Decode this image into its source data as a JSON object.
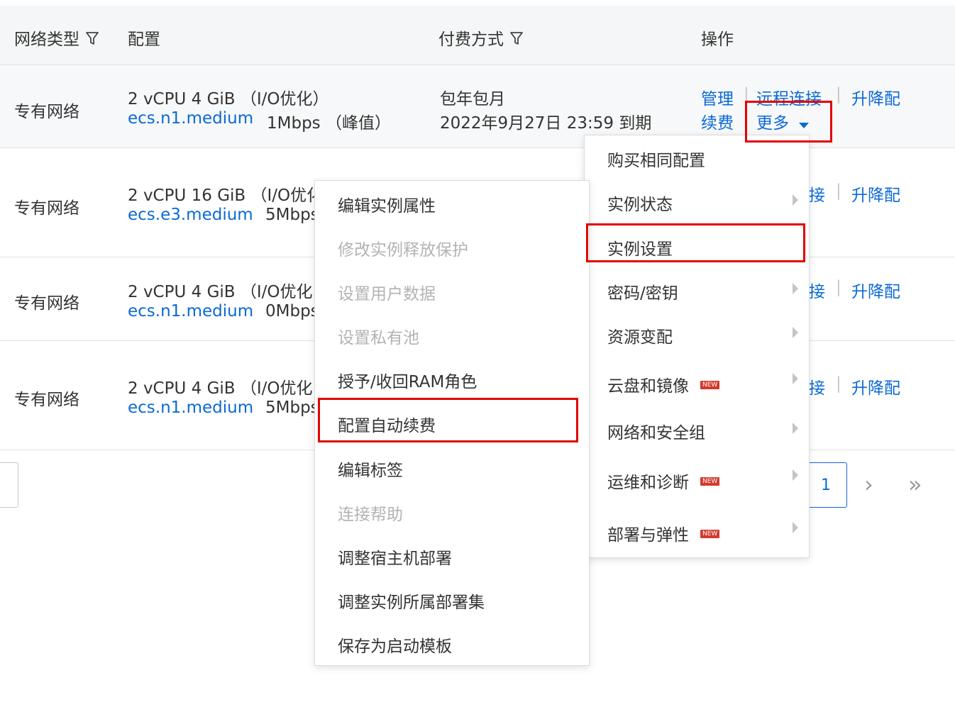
{
  "table": {
    "columns": {
      "network_type": "网络类型",
      "config": "配置",
      "payment": "付费方式",
      "actions": "操作"
    },
    "rows": [
      {
        "network": "专有网络",
        "spec": "2 vCPU 4 GiB （I/O优化）",
        "instance_type": "ecs.n1.medium",
        "bandwidth": "1Mbps （峰值）",
        "payment_mode": "包年包月",
        "expiry": "2022年9月27日 23:59 到期"
      },
      {
        "network": "专有网络",
        "spec": "2 vCPU 16 GiB （I/O优化",
        "instance_type": "ecs.e3.medium",
        "bandwidth": "5Mbps"
      },
      {
        "network": "专有网络",
        "spec": "2 vCPU 4 GiB （I/O优化",
        "instance_type": "ecs.n1.medium",
        "bandwidth": "0Mbps"
      },
      {
        "network": "专有网络",
        "spec": "2 vCPU 4 GiB （I/O优化",
        "instance_type": "ecs.n1.medium",
        "bandwidth": "5Mbps"
      }
    ],
    "actions": {
      "manage": "管理",
      "remote_connect": "远程连接",
      "remote_connect_partial": "接",
      "upgrade": "升降配",
      "renew": "续费",
      "more": "更多",
      "separator": "|"
    }
  },
  "pagination": {
    "current_page": "1",
    "next": "›",
    "last": "»"
  },
  "more_menu": {
    "items": [
      {
        "label": "购买相同配置",
        "submenu": false,
        "new": false
      },
      {
        "label": "实例状态",
        "submenu": true,
        "new": false
      },
      {
        "label": "实例设置",
        "submenu": true,
        "new": false
      },
      {
        "label": "密码/密钥",
        "submenu": true,
        "new": false
      },
      {
        "label": "资源变配",
        "submenu": true,
        "new": false
      },
      {
        "label": "云盘和镜像",
        "submenu": true,
        "new": true
      },
      {
        "label": "网络和安全组",
        "submenu": true,
        "new": false
      },
      {
        "label": "运维和诊断",
        "submenu": true,
        "new": true
      },
      {
        "label": "部署与弹性",
        "submenu": true,
        "new": true
      }
    ],
    "new_badge": "NEW"
  },
  "settings_submenu": {
    "items": [
      {
        "label": "编辑实例属性",
        "disabled": false
      },
      {
        "label": "修改实例释放保护",
        "disabled": true
      },
      {
        "label": "设置用户数据",
        "disabled": true
      },
      {
        "label": "设置私有池",
        "disabled": true
      },
      {
        "label": "授予/收回RAM角色",
        "disabled": false
      },
      {
        "label": "配置自动续费",
        "disabled": false
      },
      {
        "label": "编辑标签",
        "disabled": false
      },
      {
        "label": "连接帮助",
        "disabled": true
      },
      {
        "label": "调整宿主机部署",
        "disabled": false
      },
      {
        "label": "调整实例所属部署集",
        "disabled": false
      },
      {
        "label": "保存为启动模板",
        "disabled": false
      }
    ]
  },
  "colors": {
    "link": "#0a6ad6",
    "highlight": "#e30000",
    "new_badge": "#d23b2e",
    "disabled_text": "#b3b3b3"
  }
}
